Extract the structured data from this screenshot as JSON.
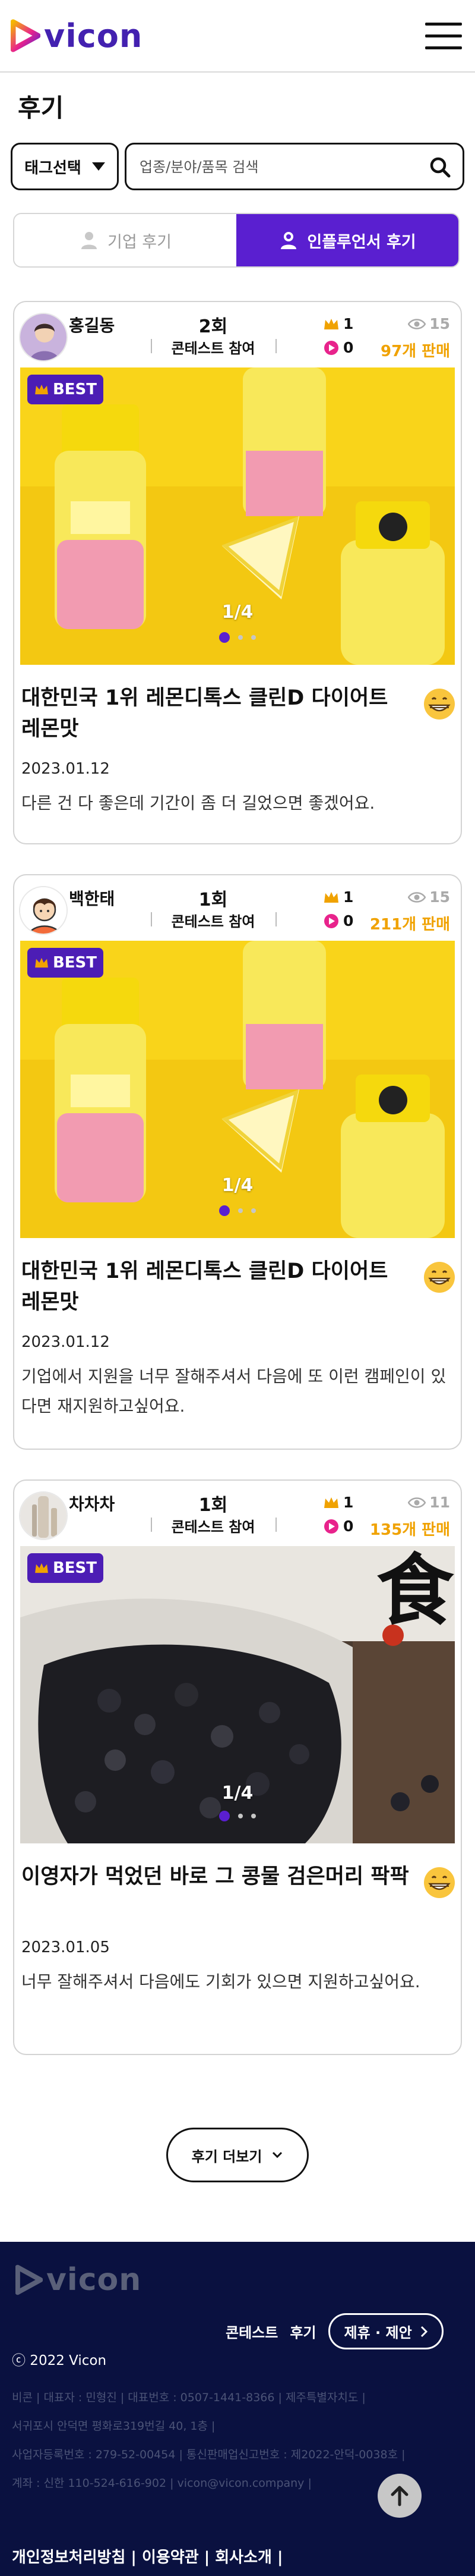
{
  "brand": {
    "name": "vicon",
    "accent": "#5a1fd0",
    "footer_bg": "#0a1140",
    "gold": "#f0a200"
  },
  "page": {
    "title": "후기"
  },
  "search": {
    "tag_select": "태그선택",
    "placeholder": "업종/분야/품목 검색"
  },
  "tabs": [
    {
      "label": "기업 후기",
      "active": false
    },
    {
      "label": "인플루언서 후기",
      "active": true
    }
  ],
  "reviews": [
    {
      "username": "홍길동",
      "contest_count": "2회",
      "contest_label": "콘테스트 참여",
      "crown": "1",
      "play": "0",
      "views": "15",
      "sold": "97개 판매",
      "best": "BEST",
      "counter": "1/4",
      "title": "대한민국 1위 레몬디톡스 클린D 다이어트 레몬맛",
      "date": "2023.01.12",
      "body": "다른 건 다 좋은데 기간이 좀 더 길었으면 좋겠어요.",
      "product_label": "클린D 다이어트 레몬맛"
    },
    {
      "username": "백한태",
      "contest_count": "1회",
      "contest_label": "콘테스트 참여",
      "crown": "1",
      "play": "0",
      "views": "15",
      "sold": "211개 판매",
      "best": "BEST",
      "counter": "1/4",
      "title": "대한민국 1위 레몬디톡스 클린D 다이어트 레몬맛",
      "date": "2023.01.12",
      "body": "기업에서 지원을 너무 잘해주셔서 다음에 또 이런 캠페인이 있다면 재지원하고싶어요.",
      "product_label": "클린D 다이어트 레몬맛"
    },
    {
      "username": "차차차",
      "contest_count": "1회",
      "contest_label": "콘테스트 참여",
      "crown": "1",
      "play": "0",
      "views": "11",
      "sold": "135개 판매",
      "best": "BEST",
      "counter": "1/4",
      "title": "이영자가 먹었던 바로 그 콩물 검은머리 팍팍",
      "date": "2023.01.05",
      "body": "너무 잘해주셔서 다음에도 기회가 있으면 지원하고싶어요.",
      "brush_char": "食"
    }
  ],
  "more_button": "후기 더보기",
  "footer": {
    "logo": "vicon",
    "links": [
      "콘테스트",
      "후기"
    ],
    "partner": "제휴 · 제안",
    "copyright": "ⓒ 2022 Vicon",
    "info_lines": [
      "비콘 | 대표자 : 민형진 | 대표번호 : 0507-1441-8366 | 제주특별자치도 |",
      "서귀포시 안덕면 평화로319번길 40, 1층 |",
      "사업자등록번호 : 279-52-00454 | 통신판매업신고번호 : 제2022-안덕-0038호 |",
      "계좌 : 신한 110-524-616-902 | vicon@vicon.company |"
    ],
    "policy": "개인정보처리방침 | 이용약관 | 회사소개 |"
  }
}
